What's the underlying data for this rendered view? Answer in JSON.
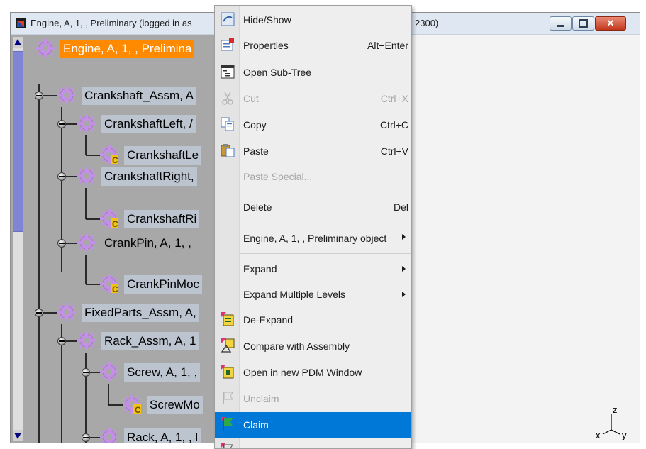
{
  "window": {
    "title": "Engine, A, 1, , Preliminary (logged in as",
    "title_tail": "2300)"
  },
  "tree": {
    "nodes": [
      {
        "label": "Engine, A, 1, , Prelimina"
      },
      {
        "label": "Crankshaft_Assm, A"
      },
      {
        "label": "CrankshaftLeft, /"
      },
      {
        "label": "CrankshaftLe"
      },
      {
        "label": "CrankshaftRight,"
      },
      {
        "label": "CrankshaftRi"
      },
      {
        "label": "CrankPin, A, 1, ,"
      },
      {
        "label": "CrankPinMoc"
      },
      {
        "label": "FixedParts_Assm, A,"
      },
      {
        "label": "Rack_Assm, A, 1"
      },
      {
        "label": "Screw, A, 1, ,"
      },
      {
        "label": "ScrewMo"
      },
      {
        "label": "Rack, A, 1, , l"
      }
    ],
    "axis_labels": {
      "z": "z",
      "x": "x",
      "y": "y"
    }
  },
  "menu": {
    "items": [
      {
        "label": "Hide/Show",
        "icon": "hide-show-icon"
      },
      {
        "label": "Properties",
        "shortcut": "Alt+Enter",
        "icon": "properties-icon"
      },
      {
        "label": "Open Sub-Tree",
        "icon": "sub-tree-icon"
      },
      {
        "label": "Cut",
        "shortcut": "Ctrl+X",
        "icon": "scissors-icon",
        "disabled": true
      },
      {
        "label": "Copy",
        "shortcut": "Ctrl+C",
        "icon": "copy-icon"
      },
      {
        "label": "Paste",
        "shortcut": "Ctrl+V",
        "icon": "paste-icon"
      },
      {
        "label": "Paste Special...",
        "disabled": true
      },
      {
        "label": "Delete",
        "shortcut": "Del"
      },
      {
        "label": "Engine, A, 1, , Preliminary object",
        "submenu": true
      },
      {
        "label": "Expand",
        "submenu": true
      },
      {
        "label": "Expand Multiple Levels",
        "submenu": true
      },
      {
        "label": "De-Expand",
        "icon": "de-expand-icon"
      },
      {
        "label": "Compare with Assembly",
        "icon": "compare-icon"
      },
      {
        "label": "Open in new PDM Window",
        "icon": "pdm-window-icon"
      },
      {
        "label": "Unclaim",
        "icon": "unclaim-flag-icon",
        "disabled": true
      },
      {
        "label": "Claim",
        "icon": "claim-flag-icon",
        "highlighted": true
      },
      {
        "label": "Unclaim all",
        "icon": "unclaim-all-icon"
      }
    ]
  },
  "colors": {
    "selection": "#ff8a00",
    "menu_highlight": "#0078d7",
    "scroll_thumb": "#7f84d4",
    "tree_background": "#a8a8a8"
  }
}
